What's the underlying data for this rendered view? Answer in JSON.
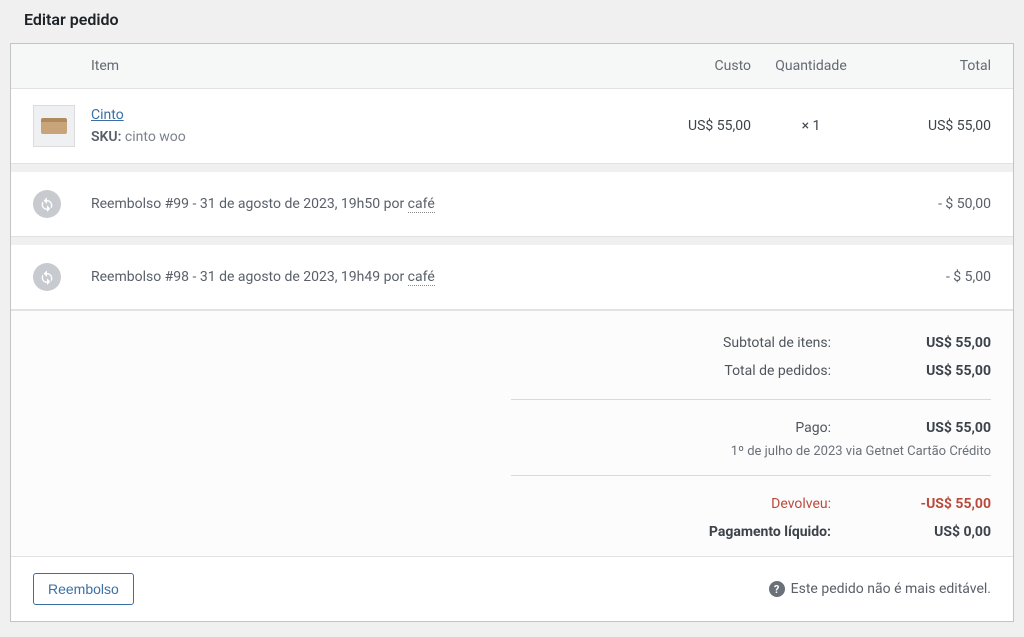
{
  "page": {
    "title": "Editar pedido"
  },
  "columns": {
    "item": "Item",
    "cost": "Custo",
    "qty": "Quantidade",
    "total": "Total"
  },
  "items": [
    {
      "name": "Cinto",
      "sku_label": "SKU:",
      "sku": "cinto woo",
      "cost": "US$ 55,00",
      "qty": "× 1",
      "total": "US$ 55,00"
    }
  ],
  "refunds": [
    {
      "text_prefix": "Reembolso #99 - 31 de agosto de 2023, 19h50 por",
      "by": "café",
      "amount": "- $ 50,00"
    },
    {
      "text_prefix": "Reembolso #98 - 31 de agosto de 2023, 19h49 por",
      "by": "café",
      "amount": "- $ 5,00"
    }
  ],
  "totals": {
    "subtotal_label": "Subtotal de itens:",
    "subtotal": "US$ 55,00",
    "order_total_label": "Total de pedidos:",
    "order_total": "US$ 55,00",
    "paid_label": "Pago:",
    "paid": "US$ 55,00",
    "paid_meta": "1º de julho de 2023 via Getnet Cartão Crédito",
    "refunded_label": "Devolveu:",
    "refunded": "-US$ 55,00",
    "net_label": "Pagamento líquido:",
    "net": "US$ 0,00"
  },
  "footer": {
    "refund_button": "Reembolso",
    "notice": "Este pedido não é mais editável."
  }
}
